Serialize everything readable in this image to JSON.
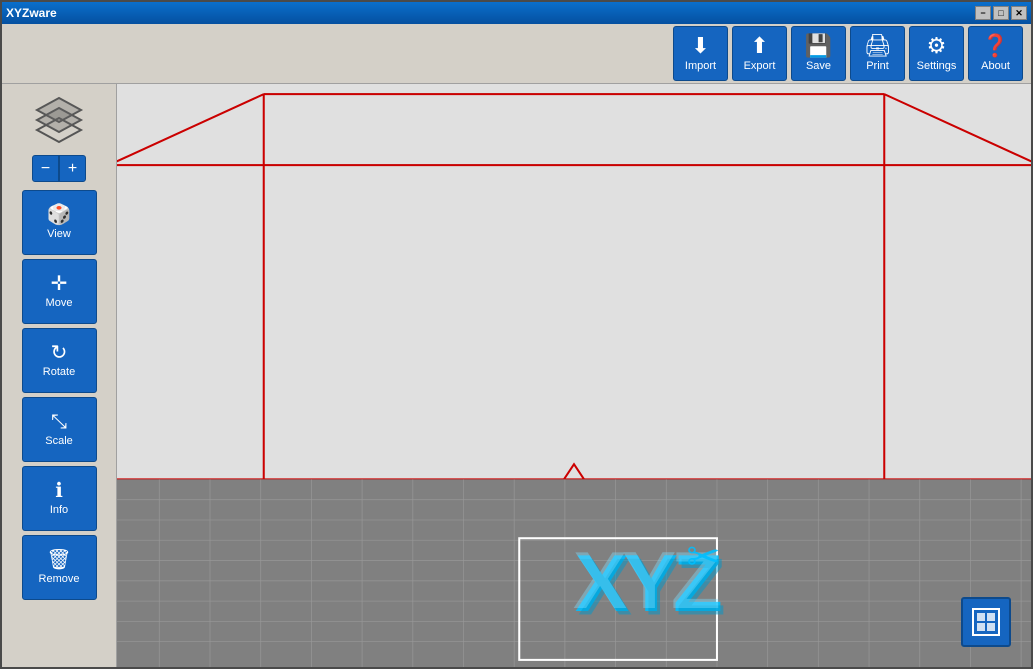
{
  "window": {
    "title": "XYZware",
    "controls": {
      "minimize": "−",
      "maximize": "□",
      "close": "✕"
    }
  },
  "toolbar": {
    "buttons": [
      {
        "id": "import",
        "label": "Import",
        "icon": "⬇"
      },
      {
        "id": "export",
        "label": "Export",
        "icon": "⬆"
      },
      {
        "id": "save",
        "label": "Save",
        "icon": "💾"
      },
      {
        "id": "print",
        "label": "Print",
        "icon": "🖨"
      },
      {
        "id": "settings",
        "label": "Settings",
        "icon": "⚙"
      },
      {
        "id": "about",
        "label": "About",
        "icon": "❓"
      }
    ]
  },
  "sidebar": {
    "zoom_minus": "−",
    "zoom_plus": "+",
    "buttons": [
      {
        "id": "view",
        "label": "View",
        "icon": "🎲"
      },
      {
        "id": "move",
        "label": "Move",
        "icon": "✛"
      },
      {
        "id": "rotate",
        "label": "Rotate",
        "icon": "↻"
      },
      {
        "id": "scale",
        "label": "Scale",
        "icon": "⤡"
      },
      {
        "id": "info",
        "label": "Info",
        "icon": "ℹ"
      },
      {
        "id": "remove",
        "label": "Remove",
        "icon": "🗑"
      }
    ]
  },
  "viewport": {
    "bottom_right_icon": "□"
  }
}
